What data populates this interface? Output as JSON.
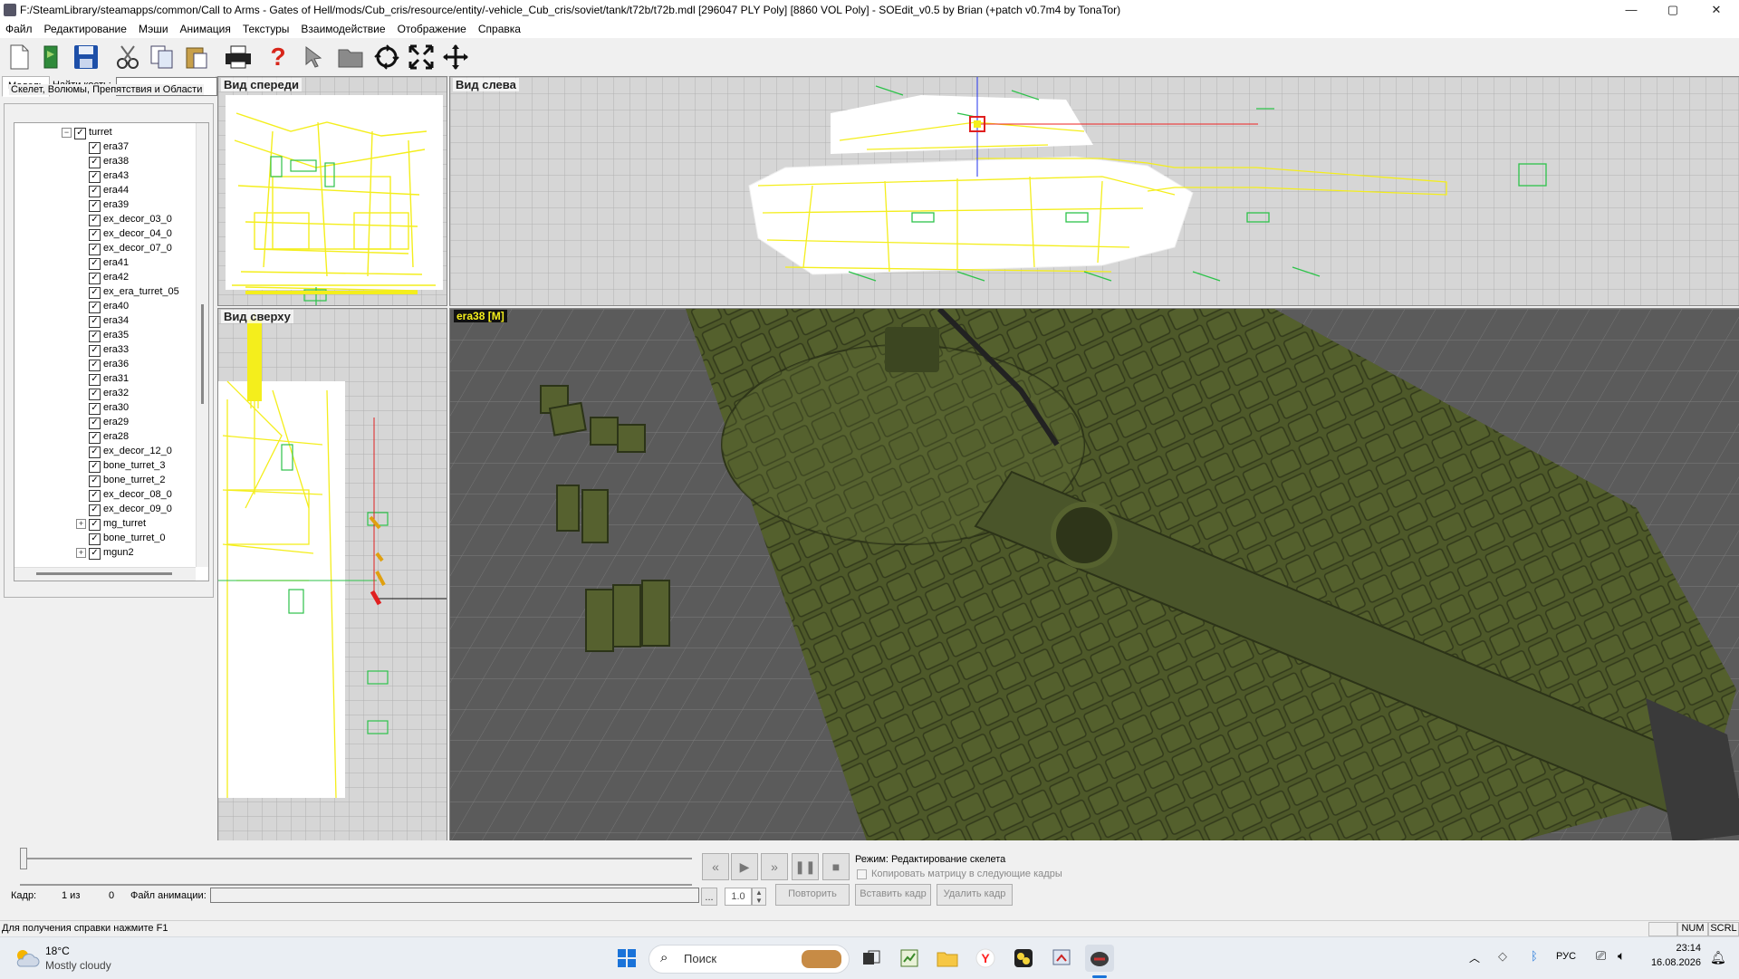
{
  "window": {
    "title": "F:/SteamLibrary/steamapps/common/Call to Arms - Gates of Hell/mods/Cub_cris/resource/entity/-vehicle_Cub_cris/soviet/tank/t72b/t72b.mdl [296047 PLY Poly] [8860 VOL Poly] - SOEdit_v0.5 by Brian (+patch v0.7m4 by TonaTor)",
    "minimize": "—",
    "maximize": "▢",
    "close": "✕"
  },
  "menu": [
    "Файл",
    "Редактирование",
    "Мэши",
    "Анимация",
    "Текстуры",
    "Взаимодействие",
    "Отображение",
    "Справка"
  ],
  "toolbar": {
    "icons": [
      "new-file-icon",
      "open-file-icon",
      "save-icon",
      "cut-icon",
      "copy-icon",
      "paste-icon",
      "print-icon",
      "help-icon",
      "pointer-icon",
      "folder-icon",
      "rotate-icon",
      "fit-icon",
      "move-icon"
    ]
  },
  "left": {
    "tabs": [
      "Модель",
      "Найти кость:"
    ],
    "search_value": "",
    "group_title": "Скелет, Волюмы, Препятствия и Области",
    "tree": [
      {
        "label": "turret",
        "level": 0,
        "expander": "−"
      },
      {
        "label": "era37",
        "level": 1,
        "expander": ""
      },
      {
        "label": "era38",
        "level": 1,
        "expander": ""
      },
      {
        "label": "era43",
        "level": 1,
        "expander": ""
      },
      {
        "label": "era44",
        "level": 1,
        "expander": ""
      },
      {
        "label": "era39",
        "level": 1,
        "expander": ""
      },
      {
        "label": "ex_decor_03_0",
        "level": 1,
        "expander": ""
      },
      {
        "label": "ex_decor_04_0",
        "level": 1,
        "expander": ""
      },
      {
        "label": "ex_decor_07_0",
        "level": 1,
        "expander": ""
      },
      {
        "label": "era41",
        "level": 1,
        "expander": ""
      },
      {
        "label": "era42",
        "level": 1,
        "expander": ""
      },
      {
        "label": "ex_era_turret_05",
        "level": 1,
        "expander": ""
      },
      {
        "label": "era40",
        "level": 1,
        "expander": ""
      },
      {
        "label": "era34",
        "level": 1,
        "expander": ""
      },
      {
        "label": "era35",
        "level": 1,
        "expander": ""
      },
      {
        "label": "era33",
        "level": 1,
        "expander": ""
      },
      {
        "label": "era36",
        "level": 1,
        "expander": ""
      },
      {
        "label": "era31",
        "level": 1,
        "expander": ""
      },
      {
        "label": "era32",
        "level": 1,
        "expander": ""
      },
      {
        "label": "era30",
        "level": 1,
        "expander": ""
      },
      {
        "label": "era29",
        "level": 1,
        "expander": ""
      },
      {
        "label": "era28",
        "level": 1,
        "expander": ""
      },
      {
        "label": "ex_decor_12_0",
        "level": 1,
        "expander": ""
      },
      {
        "label": "bone_turret_3",
        "level": 1,
        "expander": ""
      },
      {
        "label": "bone_turret_2",
        "level": 1,
        "expander": ""
      },
      {
        "label": "ex_decor_08_0",
        "level": 1,
        "expander": ""
      },
      {
        "label": "ex_decor_09_0",
        "level": 1,
        "expander": ""
      },
      {
        "label": "mg_turret",
        "level": 1,
        "expander": "+"
      },
      {
        "label": "bone_turret_0",
        "level": 1,
        "expander": ""
      },
      {
        "label": "mgun2",
        "level": 1,
        "expander": "+"
      }
    ]
  },
  "viewports": {
    "front": "Вид спереди",
    "left": "Вид слева",
    "top": "Вид сверху",
    "persp": "era38 [M]"
  },
  "anim": {
    "frame_label": "Кадр:",
    "frame_of": "1 из",
    "frame_total": "0",
    "file_label": "Файл анимации:",
    "file_value": "",
    "browse": "...",
    "speed": "1.0",
    "mode": "Режим: Редактирование скелета",
    "copy_matrix": "Копировать матрицу в следующие кадры",
    "repeat": "Повторить",
    "insert_frame": "Вставить кадр",
    "delete_frame": "Удалить кадр",
    "controls": [
      "«",
      "▶",
      "»",
      "❚❚",
      "■"
    ]
  },
  "status": {
    "help": "Для получения справки нажмите F1",
    "num": "NUM",
    "scrl": "SCRL"
  },
  "taskbar": {
    "temp": "18°C",
    "weather": "Mostly cloudy",
    "search_placeholder": "Поиск",
    "lang": "РУС",
    "time": "23:14",
    "date": "16.08.2026"
  }
}
